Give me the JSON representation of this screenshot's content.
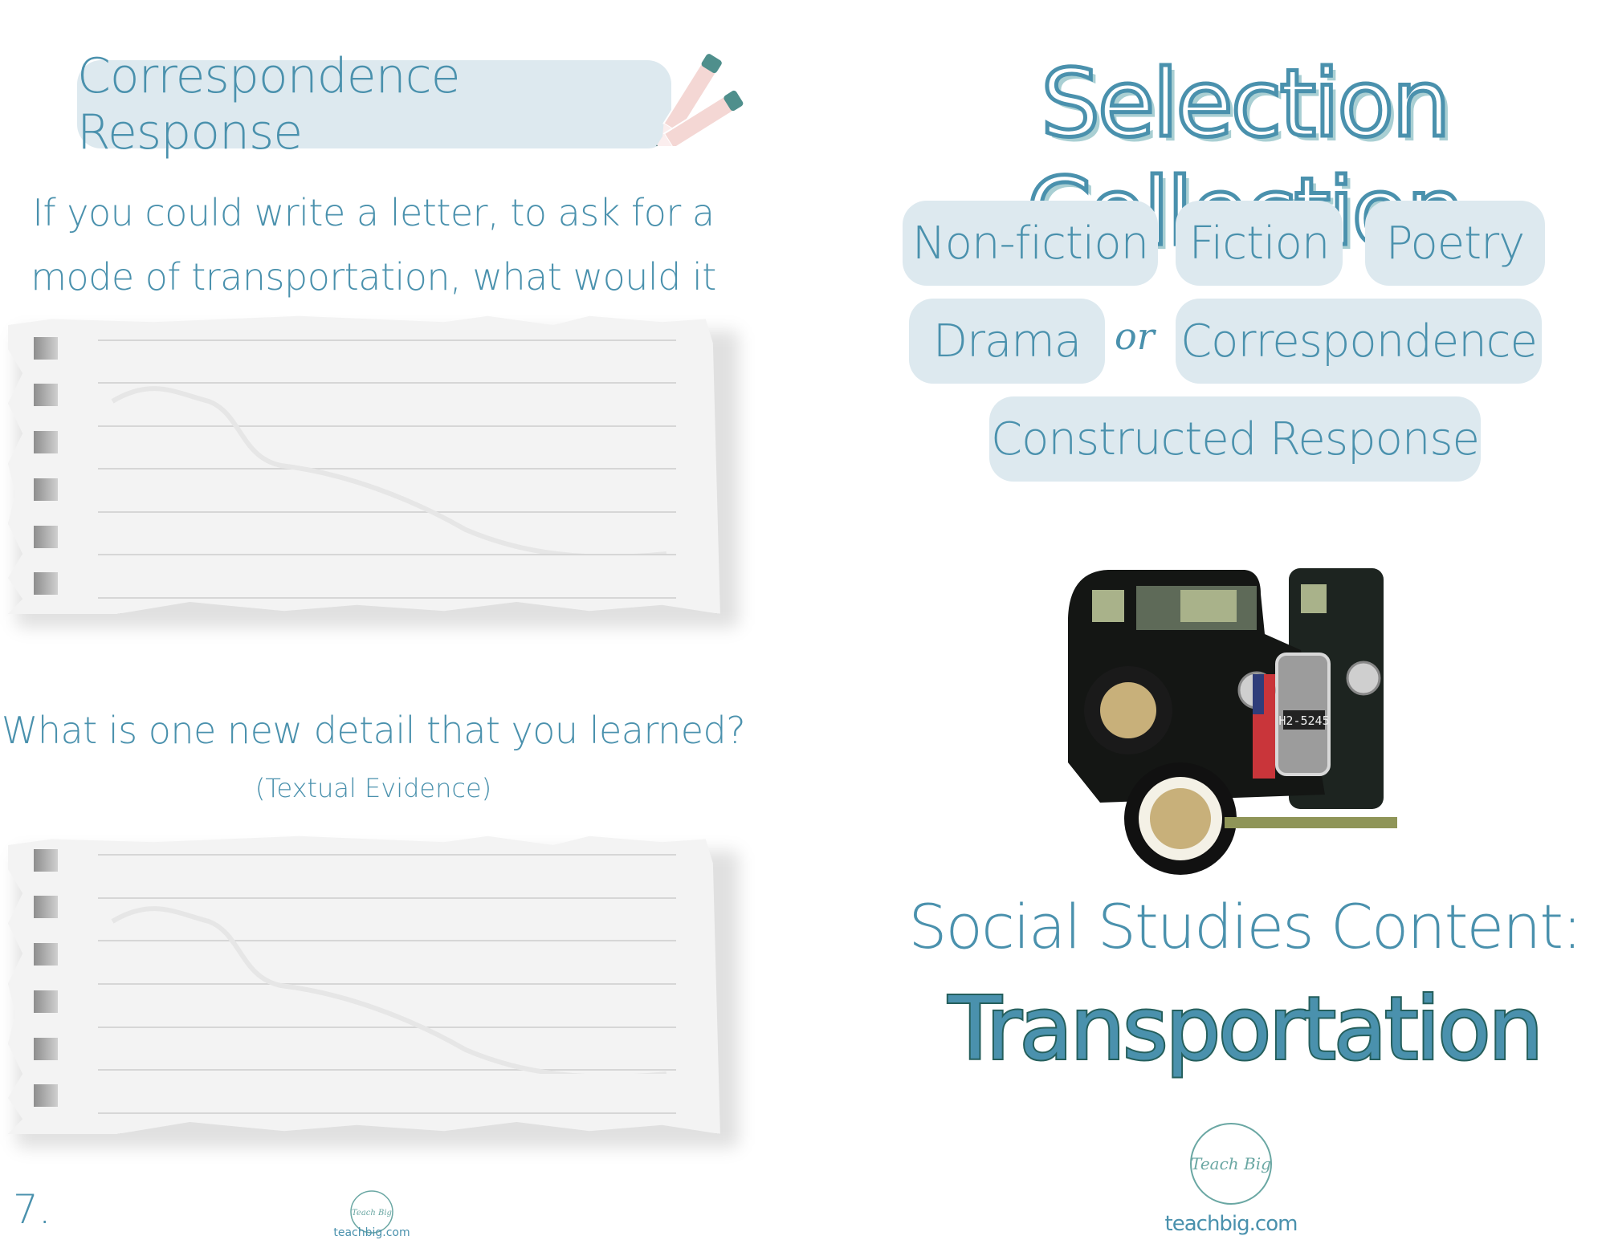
{
  "left_page": {
    "section_title": "Correspondence Response",
    "section_icon": "pencils-icon",
    "question_1": {
      "line_1": "If you could write a letter, to ask for a",
      "line_2": "mode of transportation, what would it be?"
    },
    "answer_area_1": {
      "ruled_lines": 7
    },
    "question_2": {
      "text": "What is one new detail that you learned?",
      "note": "(Textual Evidence)"
    },
    "answer_area_2": {
      "ruled_lines": 7
    },
    "page_number": "7.",
    "footer_logo": {
      "text": "Teach Big",
      "url": "teachbig.com"
    }
  },
  "right_page": {
    "title": "Selection Collection",
    "genres": [
      "Non-fiction",
      "Fiction",
      "Poetry",
      "Drama",
      "Correspondence",
      "Constructed Response"
    ],
    "or_word": "or",
    "image": {
      "subject": "vintage black car with American flag",
      "license_plate": "H2-5245"
    },
    "content_label": "Social Studies Content:",
    "topic": "Transportation",
    "footer_logo": {
      "text": "Teach Big",
      "url": "teachbig.com"
    }
  },
  "colors": {
    "accent_text": "#4a91ad",
    "pill_bg": "#dde9ef",
    "title_shadow": "#a9cfd3",
    "topic_outline": "#255f5c",
    "paper": "#f3f3f3"
  }
}
